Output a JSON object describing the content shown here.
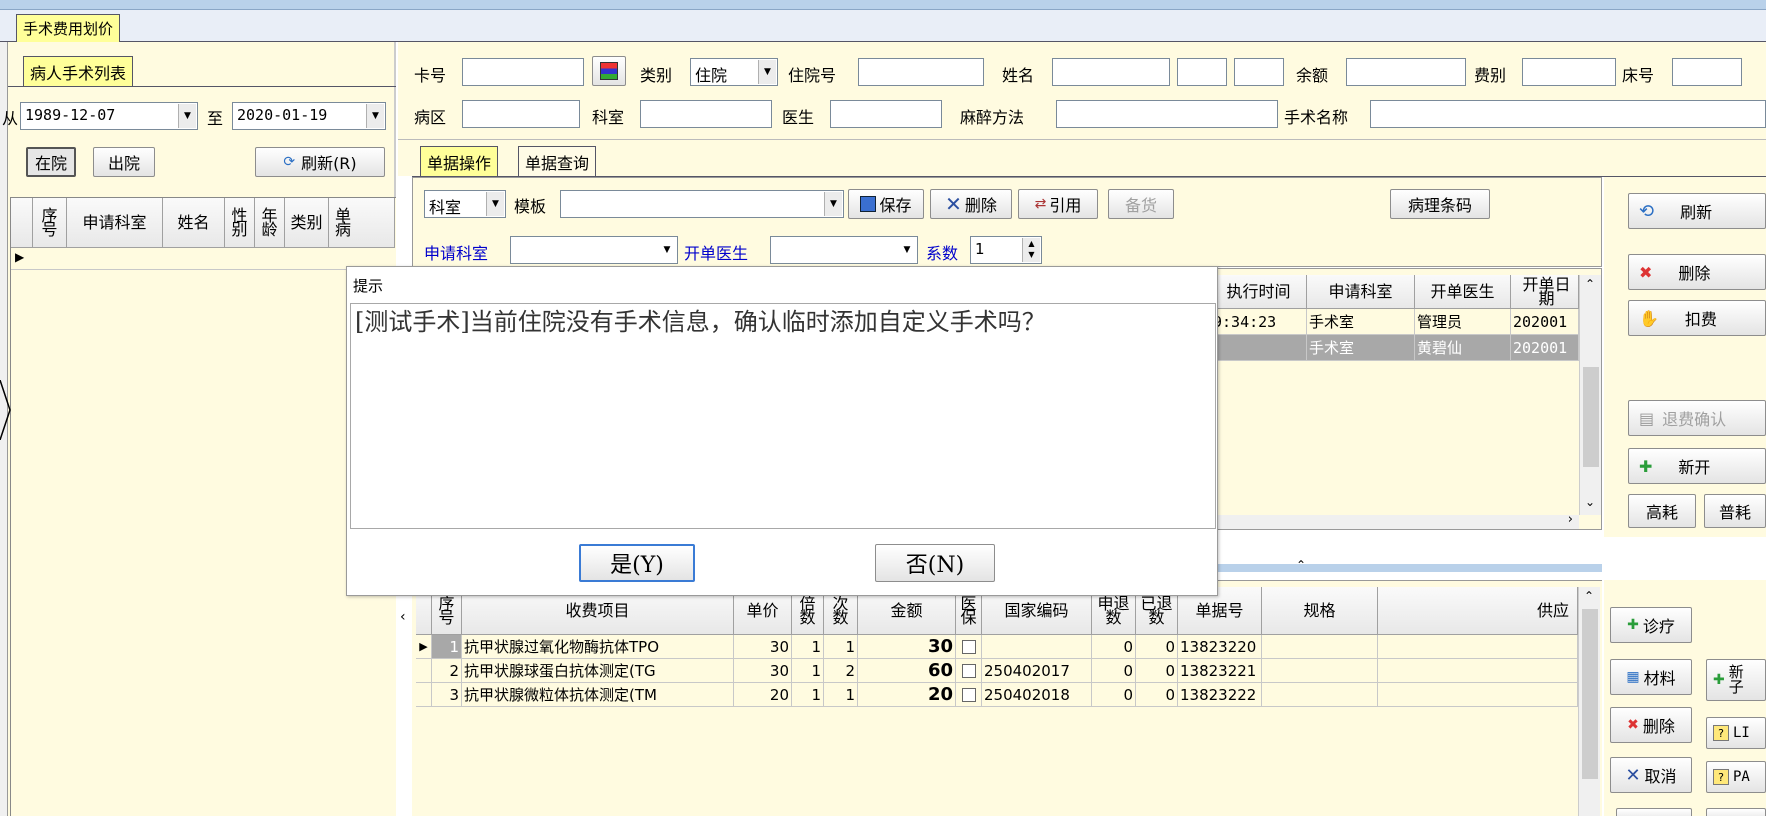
{
  "window_tab": "手术费用划价",
  "left_panel": {
    "tab": "病人手术列表",
    "from_label": "从",
    "from_date": "1989-12-07",
    "to_label": "至",
    "to_date": "2020-01-19",
    "btn_inhospital": "在院",
    "btn_discharged": "出院",
    "btn_refresh": "刷新(R)",
    "grid_headers": [
      "序号",
      "申请科室",
      "姓名",
      "性别",
      "年龄",
      "类别",
      "单病"
    ]
  },
  "patient_bar": {
    "card_label": "卡号",
    "type_label": "类别",
    "type_value": "住院",
    "inpatient_no_label": "住院号",
    "name_label": "姓名",
    "balance_label": "余额",
    "fee_type_label": "费别",
    "bed_label": "床号",
    "ward_label": "病区",
    "dept_label": "科室",
    "doctor_label": "医生",
    "anesthesia_label": "麻醉方法",
    "surgery_name_label": "手术名称"
  },
  "tabs": [
    "单据操作",
    "单据查询"
  ],
  "toolbar": {
    "dept_combo": "科室",
    "template_label": "模板",
    "save": "保存",
    "delete": "删除",
    "cite": "引用",
    "stock": "备货",
    "pathology": "病理条码",
    "apply_dept_label": "申请科室",
    "doctor_label": "开单医生",
    "coef_label": "系数",
    "coef_value": "1"
  },
  "order_grid": {
    "headers": [
      "执行时间",
      "申请科室",
      "开单医生",
      "开单日期"
    ],
    "rows": [
      [
        "9:34:23",
        "手术室",
        "管理员",
        "202001"
      ],
      [
        "",
        "手术室",
        "黄碧仙",
        "202001"
      ]
    ]
  },
  "right_buttons": {
    "refresh": "刷新",
    "delete": "删除",
    "charge": "扣费",
    "refund": "退费确认",
    "new_open": "新开",
    "high_cost": "高耗",
    "normal_cost": "普耗"
  },
  "detail_grid": {
    "headers": [
      "序号",
      "收费项目",
      "单价",
      "倍数",
      "次数",
      "金额",
      "医保",
      "国家编码",
      "申退数",
      "已退数",
      "单据号",
      "规格",
      "供应"
    ],
    "rows": [
      [
        "1",
        "抗甲状腺过氧化物酶抗体TPO",
        "30",
        "1",
        "1",
        "30",
        "",
        "0",
        "0",
        "13823220"
      ],
      [
        "2",
        "抗甲状腺球蛋白抗体测定(TG",
        "30",
        "1",
        "2",
        "60",
        "250402017",
        "0",
        "0",
        "13823221"
      ],
      [
        "3",
        "抗甲状腺微粒体抗体测定(TM",
        "20",
        "1",
        "1",
        "20",
        "250402018",
        "0",
        "0",
        "13823222"
      ]
    ]
  },
  "bottom_buttons": {
    "diagnosis": "诊疗",
    "material": "材料",
    "new_sub": "新子",
    "delete": "删除",
    "li": "LI",
    "cancel": "取消",
    "pa": "PA"
  },
  "dialog": {
    "title": "提示",
    "message": "[测试手术]当前住院没有手术信息，确认临时添加自定义手术吗？",
    "yes": "是(Y)",
    "no": "否(N)"
  },
  "colors": {
    "panel_bg": "#fffbe0",
    "tab_bg": "#ffff99",
    "frame_blue": "#b9d1ea",
    "selected_row": "#a8a8a8"
  }
}
